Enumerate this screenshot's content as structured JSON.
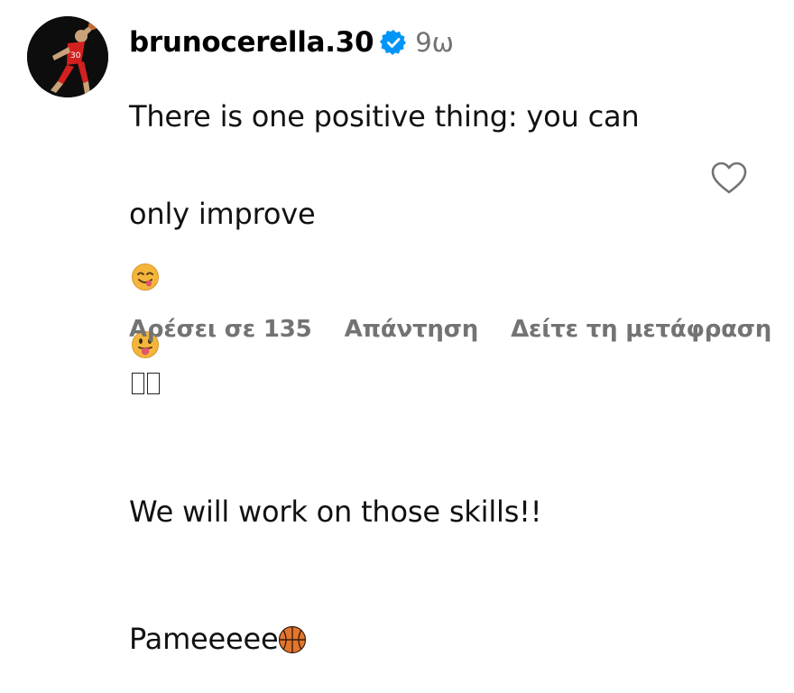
{
  "comment": {
    "username": "brunocerella.30",
    "timestamp": "9ω",
    "text_line1": "There is one positive thing: you can",
    "text_line2_prefix": "only improve",
    "text_line3": "We will work on those skills!!",
    "text_line4_prefix": "Pameeeee",
    "avatar_icon": "basketball-player-avatar",
    "verified_icon": "verified-badge-icon",
    "like_icon": "heart-outline-icon",
    "emojis": [
      "savoring-face-emoji",
      "tongue-out-emoji",
      "missing-glyph-box",
      "missing-glyph-box",
      "basketball-emoji"
    ]
  },
  "actions": {
    "likes_label": "Αρέσει σε 135",
    "reply_label": "Απάντηση",
    "translate_label": "Δείτε τη μετάφραση"
  },
  "colors": {
    "text": "#000000",
    "secondary": "#737373",
    "verified": "#0095F6",
    "background": "#FFFFFF"
  }
}
